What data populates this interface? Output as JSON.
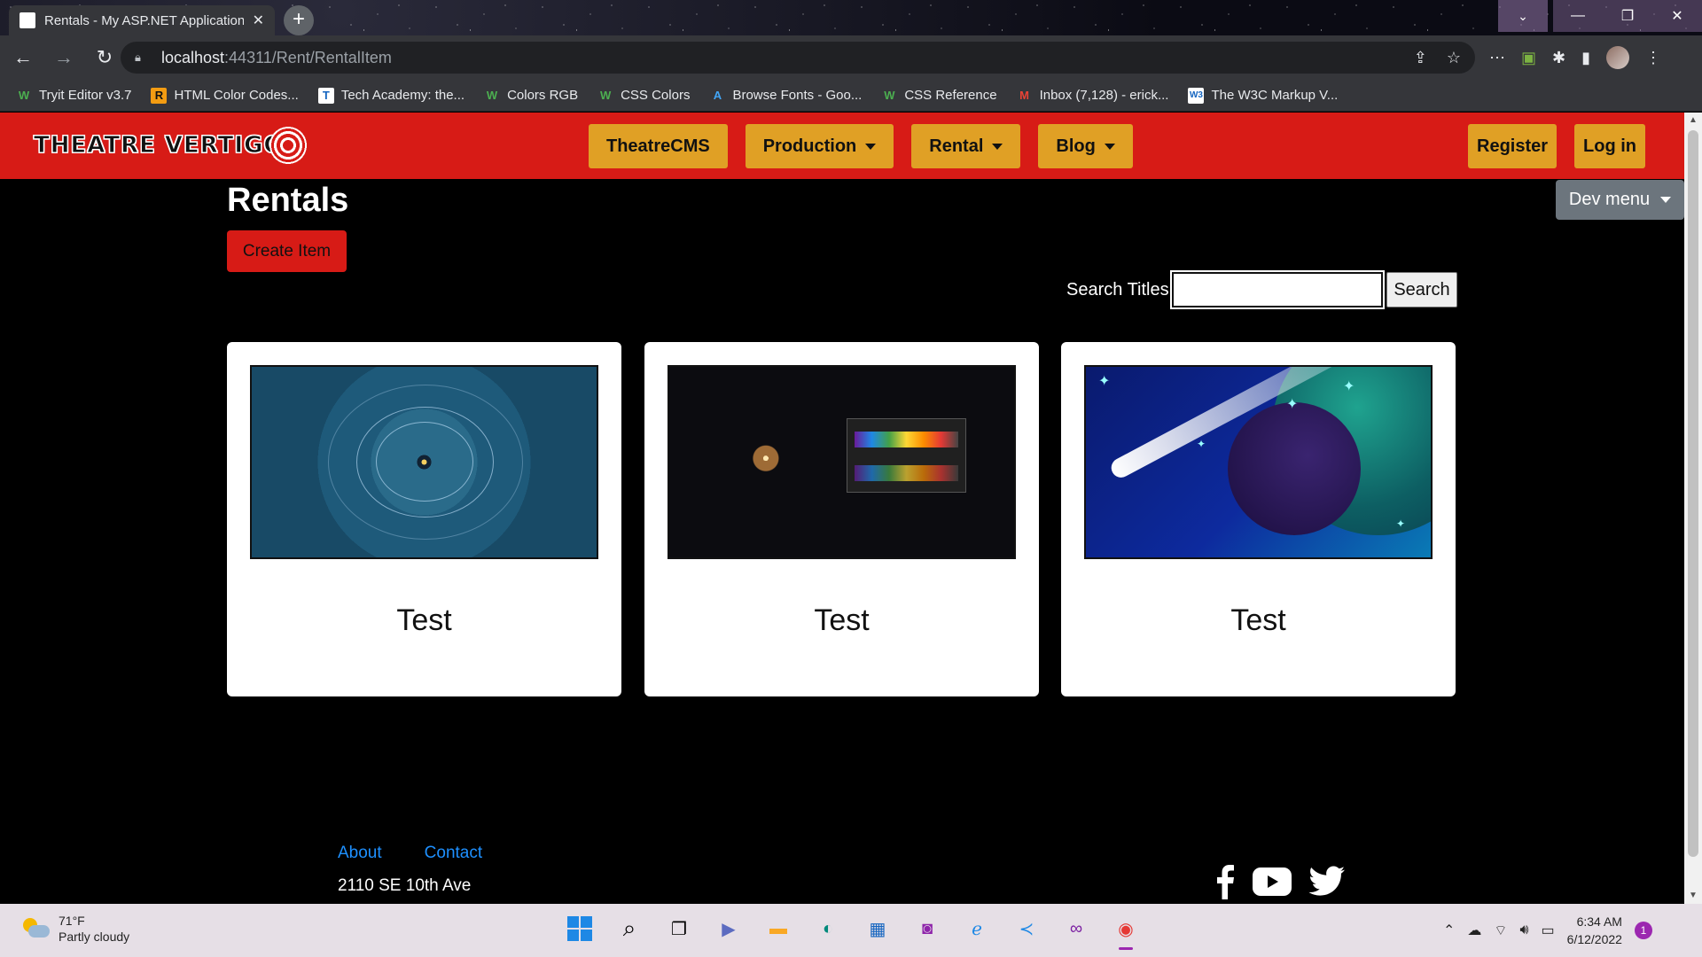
{
  "browser": {
    "tab_title": "Rentals - My ASP.NET Application",
    "url_host": "localhost",
    "url_path": ":44311/Rent/RentalItem",
    "bookmarks": [
      {
        "label": "Tryit Editor v3.7",
        "icon": "w3schools-icon"
      },
      {
        "label": "HTML Color Codes...",
        "icon": "html-color-codes-icon"
      },
      {
        "label": "Tech Academy: the...",
        "icon": "tech-academy-icon"
      },
      {
        "label": "Colors RGB",
        "icon": "w3schools-icon"
      },
      {
        "label": "CSS Colors",
        "icon": "w3schools-icon"
      },
      {
        "label": "Browse Fonts - Goo...",
        "icon": "google-fonts-icon"
      },
      {
        "label": "CSS Reference",
        "icon": "w3schools-icon"
      },
      {
        "label": "Inbox (7,128) - erick...",
        "icon": "gmail-icon"
      },
      {
        "label": "The W3C Markup V...",
        "icon": "w3c-icon"
      }
    ]
  },
  "site": {
    "logo_text": "THEATRE VERTIGO",
    "nav": {
      "theatrecms": "TheatreCMS",
      "production": "Production",
      "rental": "Rental",
      "blog": "Blog"
    },
    "register": "Register",
    "login": "Log in",
    "dev_menu": "Dev menu",
    "brand_color": "#d71b16",
    "nav_button_color": "#e0a025"
  },
  "main": {
    "title": "Rentals",
    "create_button": "Create Item",
    "search_label": "Search Titles:",
    "search_value": "",
    "search_button": "Search",
    "cards": [
      {
        "title": "Test",
        "image": "orbit-diagram"
      },
      {
        "title": "Test",
        "image": "star-spectrum"
      },
      {
        "title": "Test",
        "image": "comet-planet"
      }
    ]
  },
  "footer": {
    "about": "About",
    "contact": "Contact",
    "address": "2110 SE 10th Ave",
    "social": [
      "facebook-icon",
      "youtube-icon",
      "twitter-icon"
    ]
  },
  "taskbar": {
    "temperature": "71°F",
    "weather": "Partly cloudy",
    "time": "6:34 AM",
    "date": "6/12/2022",
    "notifications": "1"
  }
}
